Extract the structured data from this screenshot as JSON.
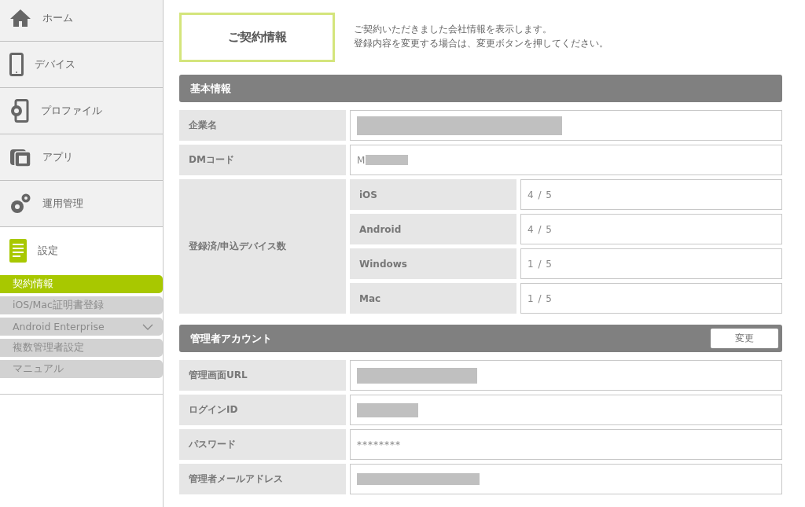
{
  "sidebar": {
    "items": [
      {
        "label": "ホーム",
        "selected": false
      },
      {
        "label": "デバイス",
        "selected": false
      },
      {
        "label": "プロファイル",
        "selected": false
      },
      {
        "label": "アプリ",
        "selected": false
      },
      {
        "label": "運用管理",
        "selected": false
      },
      {
        "label": "設定",
        "selected": true
      }
    ],
    "subitems": [
      {
        "label": "契約情報",
        "selected": true
      },
      {
        "label": "iOS/Mac証明書登録",
        "selected": false
      },
      {
        "label": "Android Enterprise",
        "selected": false,
        "expanded": false
      },
      {
        "label": "複数管理者設定",
        "selected": false
      },
      {
        "label": "マニュアル",
        "selected": false
      }
    ]
  },
  "page": {
    "title": "ご契約情報",
    "description": [
      "ご契約いただきました会社情報を表示します。",
      "登録内容を変更する場合は、変更ボタンを押してください。"
    ]
  },
  "sections": [
    {
      "title": "基本情報",
      "rows": [
        {
          "kind": "field",
          "label": "企業名",
          "value": {
            "kind": "masked"
          }
        },
        {
          "kind": "field",
          "label": "DMコード",
          "value": {
            "kind": "partly-masked",
            "text": "M"
          }
        },
        {
          "kind": "group",
          "label": "登録済/申込デバイス数",
          "rows": [
            {
              "label": "iOS",
              "value": "4 / 5"
            },
            {
              "label": "Android",
              "value": "4 / 5"
            },
            {
              "label": "Windows",
              "value": "1 / 5"
            },
            {
              "label": "Mac",
              "value": "1 / 5"
            }
          ]
        }
      ]
    },
    {
      "title": "管理者アカウント",
      "button": "変更",
      "rows": [
        {
          "kind": "field",
          "label": "管理画面URL",
          "value": {
            "kind": "masked"
          }
        },
        {
          "kind": "field",
          "label": "ログインID",
          "value": {
            "kind": "masked"
          }
        },
        {
          "kind": "field",
          "label": "パスワード",
          "value": {
            "kind": "text",
            "text": "********"
          }
        },
        {
          "kind": "field",
          "label": "管理者メールアドレス",
          "value": {
            "kind": "masked"
          }
        }
      ]
    }
  ]
}
